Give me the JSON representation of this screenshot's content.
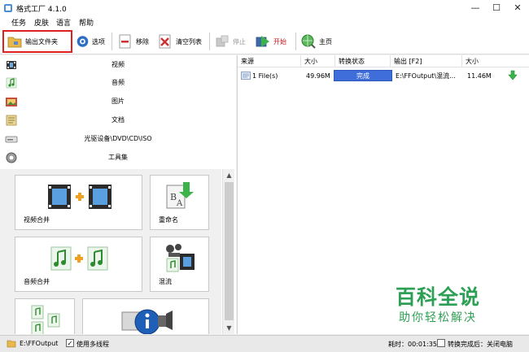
{
  "window": {
    "title": "格式工厂 4.1.0",
    "min": "—",
    "max": "☐",
    "close": "✕"
  },
  "menu": [
    "任务",
    "皮肤",
    "语言",
    "帮助"
  ],
  "toolbar": {
    "output_folder": "输出文件夹",
    "options": "选项",
    "remove": "移除",
    "clear_list": "清空列表",
    "stop": "停止",
    "start": "开始",
    "home": "主页"
  },
  "categories": [
    "视频",
    "音频",
    "图片",
    "文档",
    "光驱设备\\DVD\\CD\\ISO",
    "工具集"
  ],
  "tools": [
    {
      "label": "视频合并"
    },
    {
      "label": "重命名"
    },
    {
      "label": "音频合并"
    },
    {
      "label": "混流"
    }
  ],
  "task_table": {
    "headers": [
      "来源",
      "大小",
      "转换状态",
      "输出 [F2]",
      "大小"
    ],
    "row": {
      "source": "1 File(s)",
      "size": "49.96M",
      "status": "完成",
      "output": "E:\\FFOutput\\混流...",
      "out_size": "11.46M"
    }
  },
  "watermark": {
    "title": "百科全说",
    "subtitle": "助你轻松解决"
  },
  "statusbar": {
    "output_path": "E:\\FFOutput",
    "multithread": "使用多线程",
    "elapsed": "耗时：00:01:35",
    "after_convert": "转换完成后：关闭电脑"
  },
  "colors": {
    "accent": "#3f6edb",
    "watermark": "#2ea055",
    "highlight_border": "#e02020"
  }
}
